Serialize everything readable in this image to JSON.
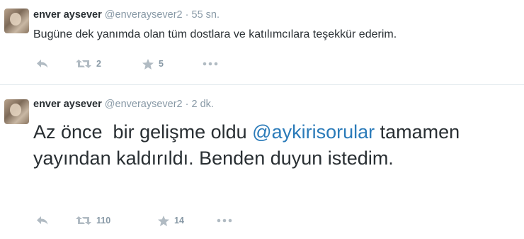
{
  "tweets": [
    {
      "name": "enver aysever",
      "handle": "@enveraysever2",
      "separator": "·",
      "time": "55 sn.",
      "text": "Bugüne dek yanımda olan tüm dostlara ve katılımcılara teşekkür ederim.",
      "retweets": "2",
      "favorites": "5"
    },
    {
      "name": "enver aysever",
      "handle": "@enveraysever2",
      "separator": "·",
      "time": "2 dk.",
      "text_before": "Az önce  bir gelişme oldu ",
      "mention": "@aykirisorular",
      "text_after": " tamamen yayından kaldırıldı. Benden duyun istedim.",
      "retweets": "110",
      "favorites": "14"
    }
  ],
  "icons": {
    "reply": "reply-icon",
    "retweet": "retweet-icon",
    "favorite": "star-icon",
    "more": "more-icon"
  },
  "colors": {
    "text": "#292f33",
    "muted": "#8899a6",
    "mention": "#2b7bb9",
    "divider": "#e1e8ed"
  }
}
